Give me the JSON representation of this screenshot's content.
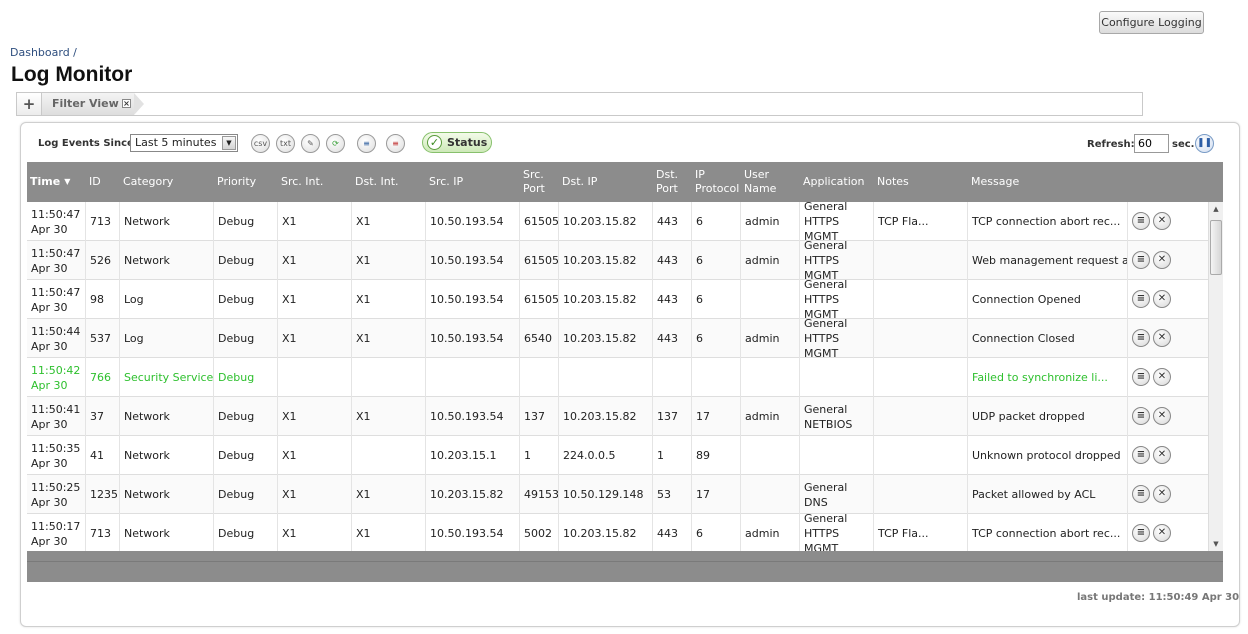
{
  "header": {
    "configure_button": "Configure Logging",
    "breadcrumb": "Dashboard /",
    "title": "Log Monitor"
  },
  "tabs": {
    "add_label": "+",
    "active_tab": "Filter View",
    "close_glyph": "×"
  },
  "toolbar": {
    "since_label": "Log Events Since:",
    "since_value": "Last 5 minutes",
    "icons": [
      "csv-export-icon",
      "txt-export-icon",
      "settings-icon",
      "refresh-icon",
      "email-log-icon",
      "clear-log-icon"
    ],
    "csv_label": "csv",
    "txt_label": "txt",
    "status_label": "Status",
    "refresh_label": "Refresh:",
    "refresh_value": "60",
    "sec_label": "sec."
  },
  "grid": {
    "columns": [
      "Time",
      "ID",
      "Category",
      "Priority",
      "Src. Int.",
      "Dst. Int.",
      "Src. IP",
      "Src. Port",
      "Dst. IP",
      "Dst. Port",
      "IP Protocol",
      "User Name",
      "Application",
      "Notes",
      "Message"
    ],
    "rows": [
      {
        "time": "11:50:47 Apr 30",
        "id": "713",
        "category": "Network",
        "priority": "Debug",
        "src_int": "X1",
        "dst_int": "X1",
        "src_ip": "10.50.193.54",
        "src_port": "61505",
        "dst_ip": "10.203.15.82",
        "dst_port": "443",
        "ip_protocol": "6",
        "user": "admin",
        "application": "General HTTPS MGMT",
        "notes": "TCP Fla...",
        "message": "TCP connection abort rec...",
        "highlight": false
      },
      {
        "time": "11:50:47 Apr 30",
        "id": "526",
        "category": "Network",
        "priority": "Debug",
        "src_int": "X1",
        "dst_int": "X1",
        "src_ip": "10.50.193.54",
        "src_port": "61505",
        "dst_ip": "10.203.15.82",
        "dst_port": "443",
        "ip_protocol": "6",
        "user": "admin",
        "application": "General HTTPS MGMT",
        "notes": "",
        "message": "Web management request a...",
        "highlight": false
      },
      {
        "time": "11:50:47 Apr 30",
        "id": "98",
        "category": "Log",
        "priority": "Debug",
        "src_int": "X1",
        "dst_int": "X1",
        "src_ip": "10.50.193.54",
        "src_port": "61505",
        "dst_ip": "10.203.15.82",
        "dst_port": "443",
        "ip_protocol": "6",
        "user": "",
        "application": "General HTTPS MGMT",
        "notes": "",
        "message": "Connection Opened",
        "highlight": false
      },
      {
        "time": "11:50:44 Apr 30",
        "id": "537",
        "category": "Log",
        "priority": "Debug",
        "src_int": "X1",
        "dst_int": "X1",
        "src_ip": "10.50.193.54",
        "src_port": "6540",
        "dst_ip": "10.203.15.82",
        "dst_port": "443",
        "ip_protocol": "6",
        "user": "admin",
        "application": "General HTTPS MGMT",
        "notes": "",
        "message": "Connection Closed",
        "highlight": false
      },
      {
        "time": "11:50:42 Apr 30",
        "id": "766",
        "category": "Security Services",
        "priority": "Debug",
        "src_int": "",
        "dst_int": "",
        "src_ip": "",
        "src_port": "",
        "dst_ip": "",
        "dst_port": "",
        "ip_protocol": "",
        "user": "",
        "application": "",
        "notes": "",
        "message": "Failed to synchronize li...",
        "highlight": true
      },
      {
        "time": "11:50:41 Apr 30",
        "id": "37",
        "category": "Network",
        "priority": "Debug",
        "src_int": "X1",
        "dst_int": "X1",
        "src_ip": "10.50.193.54",
        "src_port": "137",
        "dst_ip": "10.203.15.82",
        "dst_port": "137",
        "ip_protocol": "17",
        "user": "admin",
        "application": "General NETBIOS",
        "notes": "",
        "message": "UDP packet dropped",
        "highlight": false
      },
      {
        "time": "11:50:35 Apr 30",
        "id": "41",
        "category": "Network",
        "priority": "Debug",
        "src_int": "X1",
        "dst_int": "",
        "src_ip": "10.203.15.1",
        "src_port": "1",
        "dst_ip": "224.0.0.5",
        "dst_port": "1",
        "ip_protocol": "89",
        "user": "",
        "application": "",
        "notes": "",
        "message": "Unknown protocol dropped",
        "highlight": false
      },
      {
        "time": "11:50:25 Apr 30",
        "id": "1235",
        "category": "Network",
        "priority": "Debug",
        "src_int": "X1",
        "dst_int": "X1",
        "src_ip": "10.203.15.82",
        "src_port": "49153",
        "dst_ip": "10.50.129.148",
        "dst_port": "53",
        "ip_protocol": "17",
        "user": "",
        "application": "General DNS",
        "notes": "",
        "message": "Packet allowed by ACL",
        "highlight": false
      },
      {
        "time": "11:50:17 Apr 30",
        "id": "713",
        "category": "Network",
        "priority": "Debug",
        "src_int": "X1",
        "dst_int": "X1",
        "src_ip": "10.50.193.54",
        "src_port": "5002",
        "dst_ip": "10.203.15.82",
        "dst_port": "443",
        "ip_protocol": "6",
        "user": "admin",
        "application": "General HTTPS MGMT",
        "notes": "TCP Fla...",
        "message": "TCP connection abort rec...",
        "highlight": false
      }
    ],
    "row_actions": [
      "details-icon",
      "delete-icon"
    ],
    "sort_indicator": "▼"
  },
  "footer": {
    "last_update": "last update: 11:50:49 Apr 30"
  },
  "colors": {
    "header_bg": "#8c8c8c",
    "highlight_text": "#2ec02e",
    "status_green": "#87c06c"
  }
}
